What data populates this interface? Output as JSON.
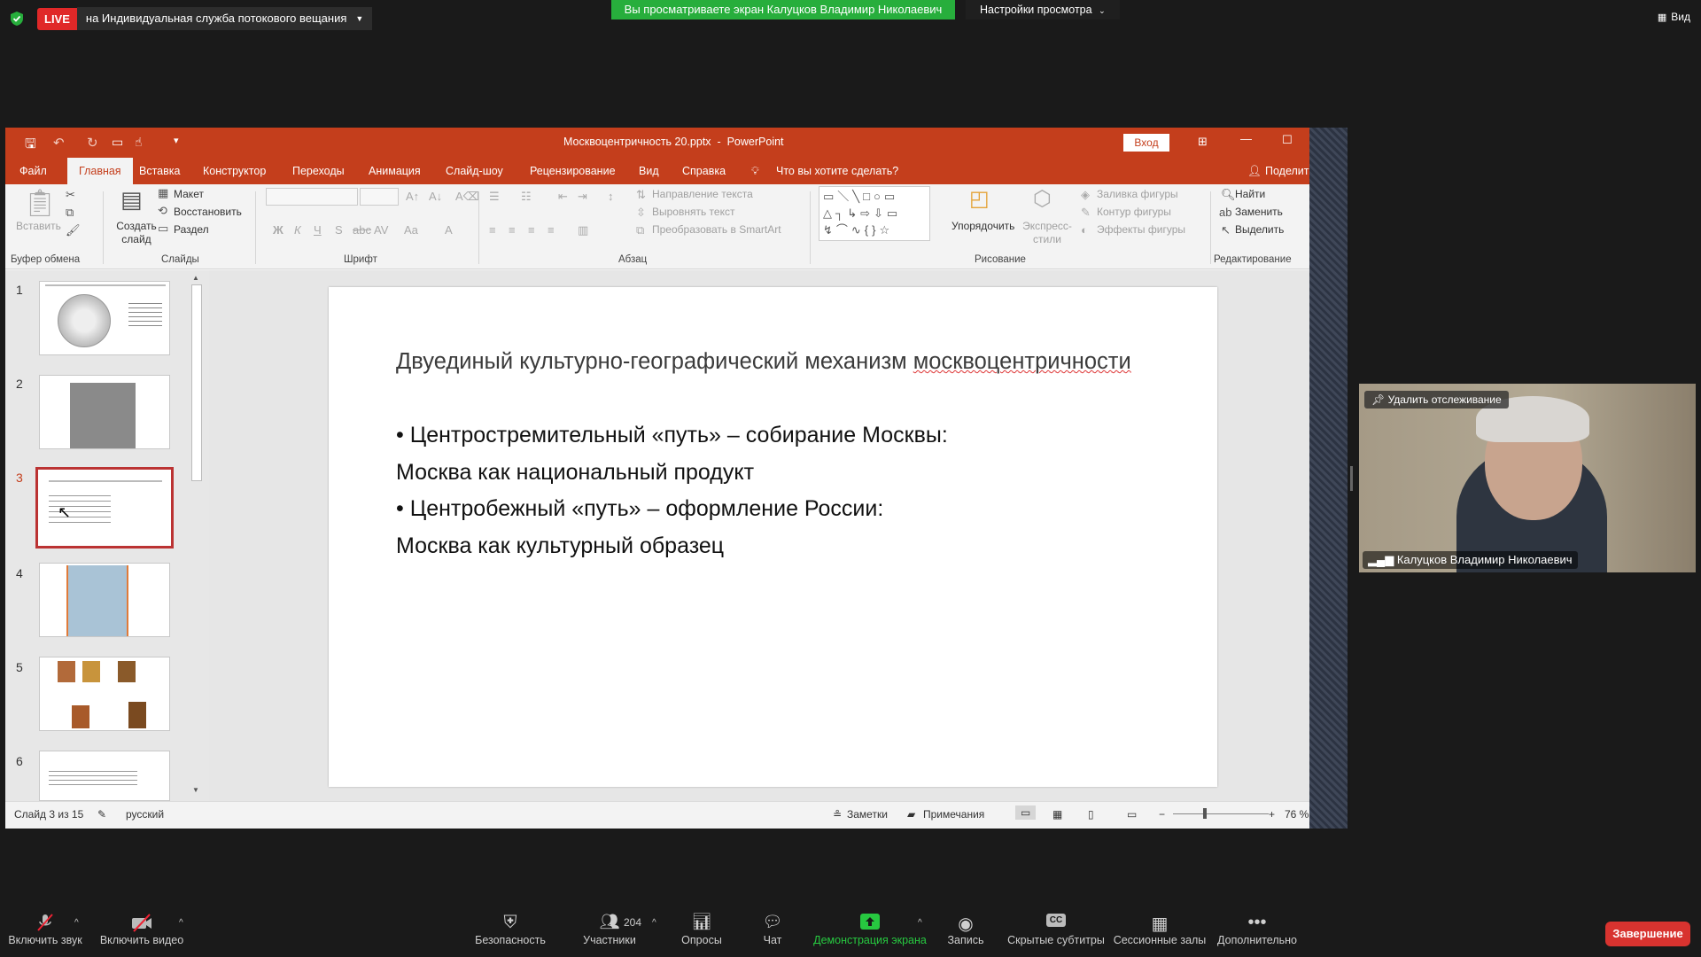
{
  "zoom_top": {
    "live_badge": "LIVE",
    "live_text": "на Индивидуальная служба потокового вещания",
    "banner": "Вы просматриваете экран Калуцков Владимир Николаевич",
    "view_settings": "Настройки просмотра",
    "view_button": "Вид"
  },
  "ppt": {
    "window_title": "Москвоцентричность 20.pptx  -  PowerPoint",
    "signin": "Вход",
    "tabs": [
      "Файл",
      "Главная",
      "Вставка",
      "Конструктор",
      "Переходы",
      "Анимация",
      "Слайд-шоу",
      "Рецензирование",
      "Вид",
      "Справка"
    ],
    "tell_me": "Что вы хотите сделать?",
    "share": "Поделит",
    "ribbon": {
      "paste": "Вставить",
      "clipboard_label": "Буфер обмена",
      "new_slide": "Создать слайд",
      "layout": "Макет",
      "reset": "Восстановить",
      "section": "Раздел",
      "slides_label": "Слайды",
      "font_label": "Шрифт",
      "text_direction": "Направление текста",
      "align_text": "Выровнять текст",
      "smartart": "Преобразовать в SmartArt",
      "paragraph_label": "Абзац",
      "arrange": "Упорядочить",
      "quick_styles": "Экспресс-стили",
      "shape_fill": "Заливка фигуры",
      "shape_outline": "Контур фигуры",
      "shape_effects": "Эффекты фигуры",
      "drawing_label": "Рисование",
      "find": "Найти",
      "replace": "Заменить",
      "select": "Выделить",
      "editing_label": "Редактирование"
    },
    "slide_numbers": [
      "1",
      "2",
      "3",
      "4",
      "5",
      "6"
    ],
    "current_slide_index": 3,
    "slide": {
      "title_part1": "Двуединый культурно-географический механизм ",
      "title_part2": "москвоцентричности",
      "line1": "• Центростремительный «путь» – собирание Москвы:",
      "line2": "Москва как национальный продукт",
      "line3": "• Центробежный «путь» – оформление России:",
      "line4": "Москва как культурный образец"
    },
    "status": {
      "slide_info": "Слайд 3 из 15",
      "language": "русский",
      "notes": "Заметки",
      "comments": "Примечания",
      "zoom": "76 %"
    }
  },
  "video": {
    "pin_label": "Удалить отслеживание",
    "name": "Калуцков Владимир Николаевич"
  },
  "toolbar": {
    "mute": "Включить звук",
    "video": "Включить видео",
    "security": "Безопасность",
    "participants": "Участники",
    "participants_count": "204",
    "polls": "Опросы",
    "chat": "Чат",
    "share": "Демонстрация экрана",
    "record": "Запись",
    "captions": "Скрытые субтитры",
    "breakout": "Сессионные залы",
    "more": "Дополнительно",
    "end": "Завершение"
  },
  "colors": {
    "ppt_accent": "#c43e1c",
    "banner_green": "#27ae3c",
    "share_green": "#27c840",
    "end_red": "#d8332f"
  }
}
